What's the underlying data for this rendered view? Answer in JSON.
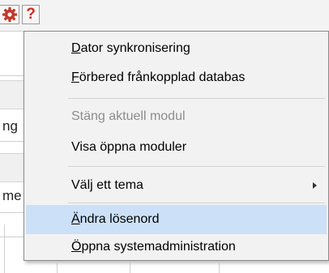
{
  "toolbar": {
    "settings_icon": "gear-icon",
    "help_icon": "help-icon",
    "help_glyph": "?",
    "settings_color": "#c0392b",
    "help_color": "#d42a1c"
  },
  "background": {
    "row1_partial_label": "ng",
    "row2_partial_label": "me"
  },
  "menu": {
    "items": [
      {
        "accel": "D",
        "rest": "ator synkronisering",
        "enabled": true
      },
      {
        "accel": "F",
        "rest": "örbered frånkopplad databas",
        "enabled": true
      },
      {
        "accel": "",
        "rest": "Stäng aktuell modul",
        "enabled": false
      },
      {
        "accel": "",
        "rest": "Visa öppna moduler",
        "enabled": true
      },
      {
        "accel": "",
        "rest": "Välj ett tema",
        "enabled": true,
        "has_submenu": true
      },
      {
        "accel": "Ä",
        "rest": "ndra lösenord",
        "enabled": true,
        "highlighted": true
      },
      {
        "accel": "Ö",
        "rest": "ppna systemadministration",
        "enabled": true
      }
    ],
    "highlight_color": "#cce0f7",
    "disabled_color": "#8d8d8d"
  }
}
